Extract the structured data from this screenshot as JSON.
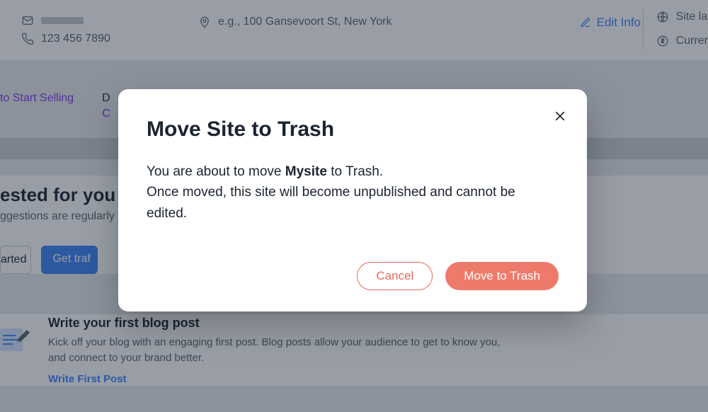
{
  "background": {
    "phone": "123 456 7890",
    "address_placeholder": "e.g., 100 Gansevoort St, New York",
    "edit_info": "Edit Info",
    "site_label": "Site la",
    "currency_label": "Currer",
    "tab_a": "to Start Selling",
    "tab_d": "D",
    "tab_c": "C",
    "suggested_title": "ested for you",
    "suggested_sub": "ggestions are regularly",
    "btn_started": "arted",
    "btn_traffic": "Get traf",
    "blog_title": "Write your first blog post",
    "blog_desc": "Kick off your blog with an engaging first post. Blog posts allow your audience to get to know you, and connect to your brand better.",
    "blog_link": "Write First Post"
  },
  "modal": {
    "title": "Move Site to Trash",
    "body_prefix": "You are about to move ",
    "site_name": "Mysite",
    "body_mid": " to Trash.",
    "body_line2": "Once moved, this site will become unpublished and cannot be edited.",
    "cancel": "Cancel",
    "confirm": "Move to Trash"
  }
}
